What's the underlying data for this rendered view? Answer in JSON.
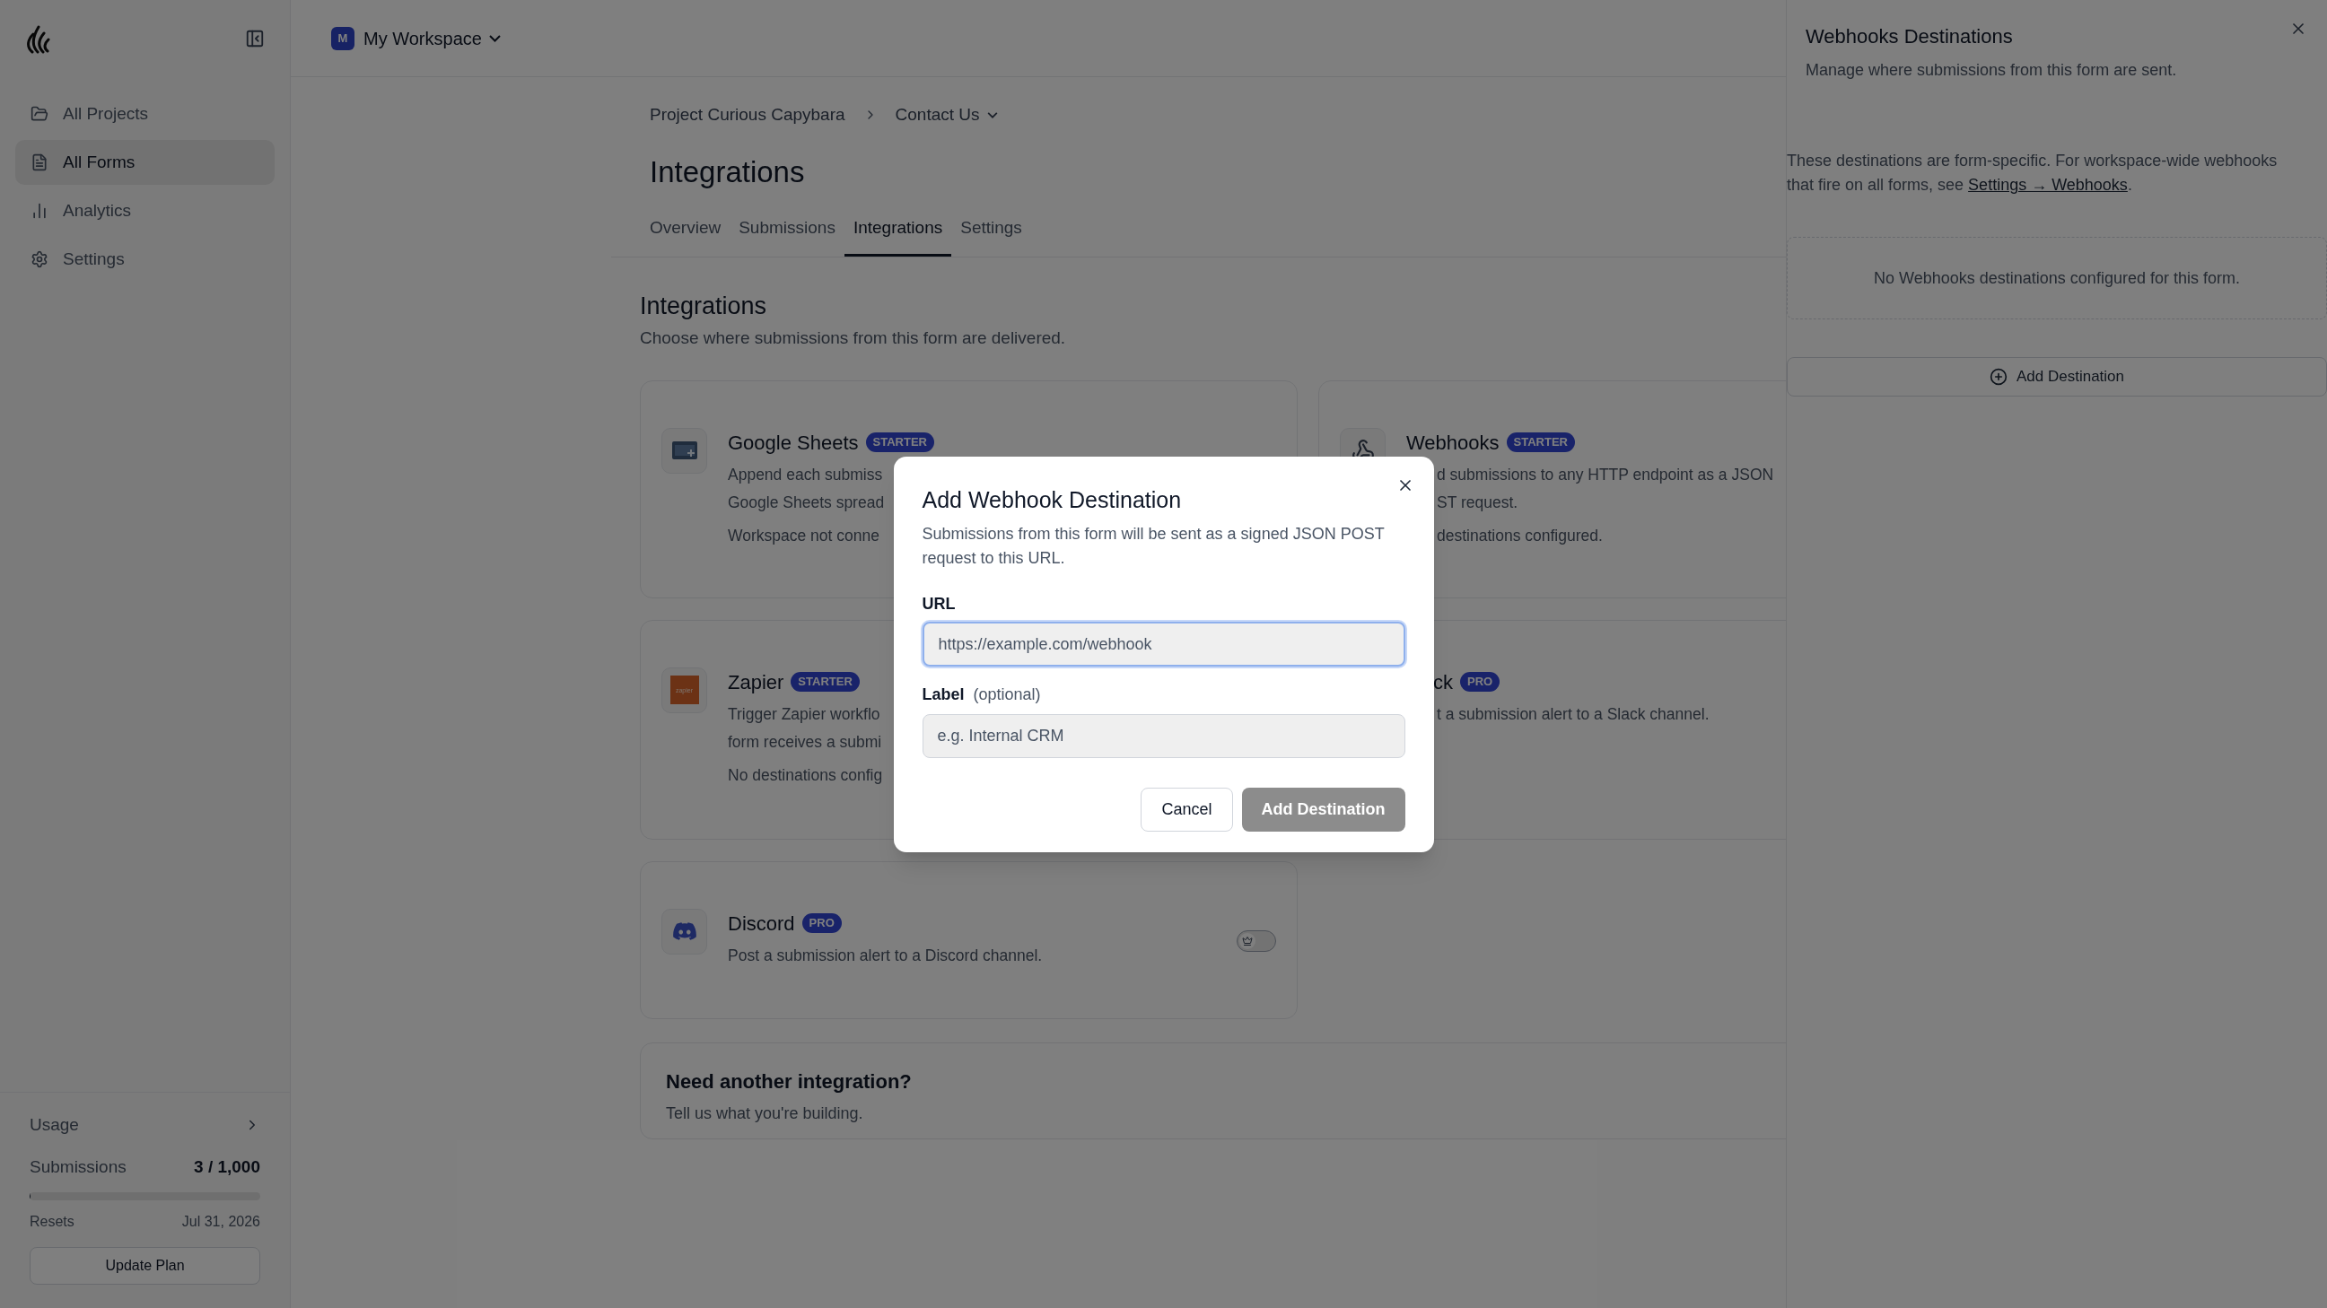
{
  "sidebar": {
    "nav": [
      {
        "kind": "projects",
        "label": "All Projects",
        "selected": false
      },
      {
        "kind": "forms",
        "label": "All Forms",
        "selected": true
      },
      {
        "kind": "analytics",
        "label": "Analytics",
        "selected": false
      },
      {
        "kind": "settings",
        "label": "Settings",
        "selected": false
      }
    ],
    "usage": {
      "title": "Usage",
      "metric": "Submissions",
      "value": "3 / 1,000",
      "level": 0.003,
      "resets_label": "Resets",
      "resets_date": "Jul 31, 2026",
      "button": "Update Plan"
    }
  },
  "header": {
    "workspace_initial": "M",
    "workspace": "My Workspace"
  },
  "breadcrumb": [
    "Project Curious Capybara",
    "Contact Us"
  ],
  "page_title": "Integrations",
  "tabs": [
    {
      "label": "Overview",
      "selected": false
    },
    {
      "label": "Submissions",
      "selected": false
    },
    {
      "label": "Integrations",
      "selected": true
    },
    {
      "label": "Settings",
      "selected": false
    }
  ],
  "section": {
    "title": "Integrations",
    "subtitle": "Choose where submissions from this form are delivered."
  },
  "integrations": [
    {
      "kind": "sheets",
      "name": "Google Sheets",
      "badge": "STARTER",
      "lines": [
        "Append each submiss",
        "Google Sheets spread"
      ],
      "status": "Workspace not conne"
    },
    {
      "kind": "webhooks",
      "name": "Webhooks",
      "badge": "STARTER",
      "lines": [
        "d submissions to any HTTP endpoint as a JSON",
        "ST request."
      ],
      "status": "destinations configured."
    },
    {
      "kind": "zapier",
      "name": "Zapier",
      "logo_text": "zapier",
      "badge": "STARTER",
      "lines": [
        "Trigger Zapier workflo",
        "form receives a submi"
      ],
      "status": "No destinations config"
    },
    {
      "kind": "slack",
      "name": "ck",
      "badge": "PRO",
      "lines": [
        "t a submission alert to a Slack channel."
      ]
    },
    {
      "kind": "discord",
      "name": "Discord",
      "badge": "PRO",
      "lines": [
        "Post a submission alert to a Discord channel."
      ],
      "on": false
    }
  ],
  "cta": {
    "title": "Need another integration?",
    "text": "Tell us what you're building."
  },
  "panel": {
    "title": "Webhooks Destinations",
    "subtitle": "Manage where submissions from this form are sent.",
    "note": "These destinations are form-specific. For workspace-wide webhooks that fire on all forms, see",
    "link": "Settings → Webhooks",
    "note_end": ".",
    "empty": "No Webhooks destinations configured for this form.",
    "button": "Add Destination"
  },
  "dialog": {
    "title": "Add Webhook Destination",
    "description": "Submissions from this form will be sent as a signed JSON POST request to this URL.",
    "url_label": "URL",
    "url_placeholder": "https://example.com/webhook",
    "url_focused": true,
    "label_label": "Label",
    "label_hint": "(optional)",
    "label_placeholder": "e.g. Internal CRM",
    "cancel": "Cancel",
    "submit": "Add Destination",
    "submit_disabled": true
  }
}
